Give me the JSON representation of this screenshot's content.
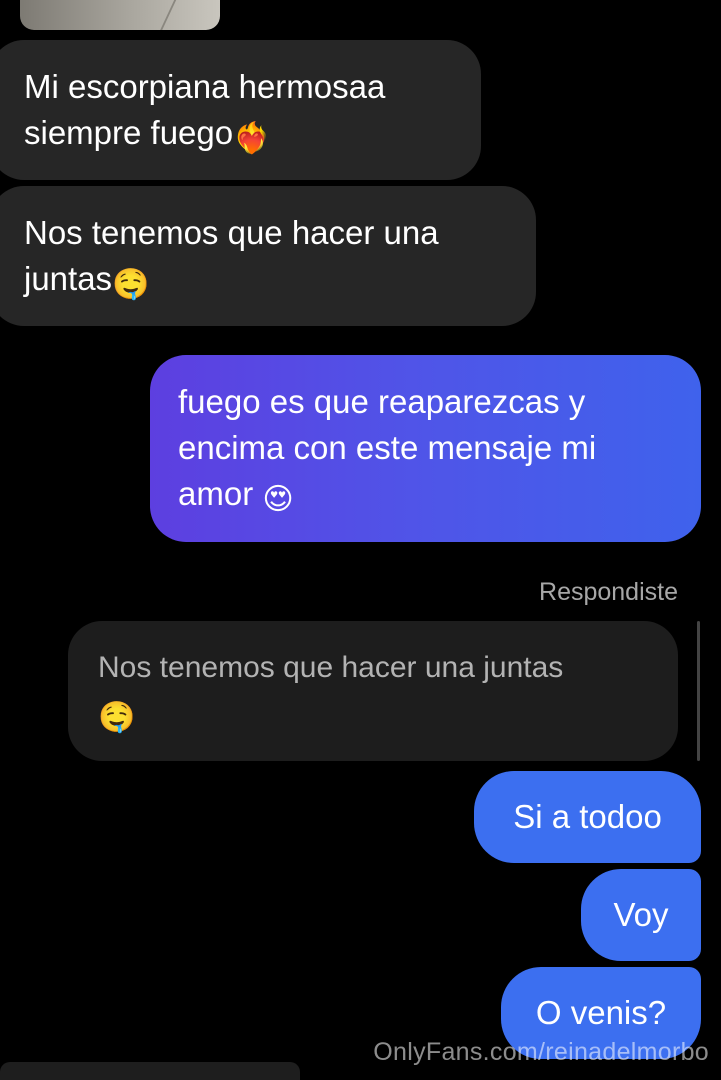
{
  "messages": {
    "incoming_1": {
      "line1": "Mi escorpiana hermosaa",
      "line2": "siempre fuego",
      "emoji": "❤️‍🔥"
    },
    "incoming_2": {
      "line1": "Nos tenemos que hacer una",
      "line2": "juntas",
      "emoji": "🤤"
    },
    "outgoing_1": {
      "line1": "fuego es que reaparezcas y",
      "line2": "encima con este mensaje mi",
      "line3": "amor",
      "emoji": "😍"
    },
    "reply": {
      "label": "Respondiste",
      "quoted_line1": "Nos tenemos que hacer una juntas",
      "quoted_emoji": "🤤"
    },
    "outgoing_2": "Si a todoo",
    "outgoing_3": "Voy",
    "outgoing_4": "O venis?"
  },
  "watermark": "OnlyFans.com/reinadelmorbo",
  "colors": {
    "background": "#000000",
    "incoming_bubble": "#262626",
    "quoted_bubble": "#1d1d1d",
    "outgoing_gradient_start": "#5d3fe0",
    "outgoing_gradient_end": "#3f62ec",
    "outgoing_blue": "#3c6ff0"
  }
}
